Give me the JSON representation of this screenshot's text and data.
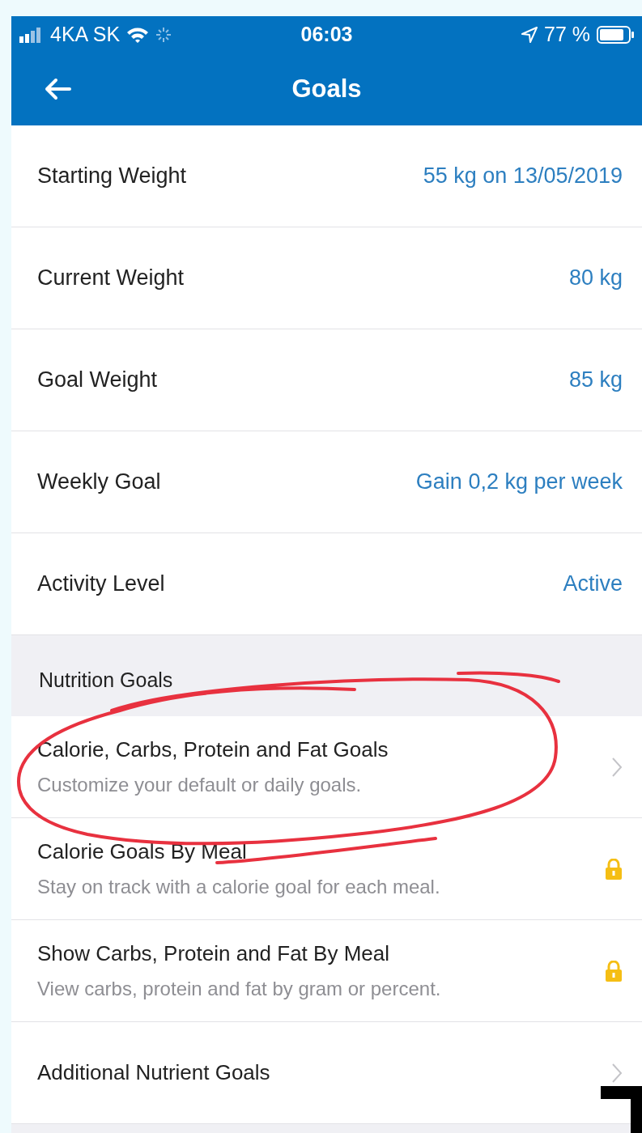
{
  "status_bar": {
    "carrier": "4KA SK",
    "time": "06:03",
    "battery": "77 %"
  },
  "header": {
    "title": "Goals"
  },
  "weight_rows": [
    {
      "label": "Starting Weight",
      "value": "55 kg on 13/05/2019"
    },
    {
      "label": "Current Weight",
      "value": "80 kg"
    },
    {
      "label": "Goal Weight",
      "value": "85 kg"
    },
    {
      "label": "Weekly Goal",
      "value": "Gain 0,2 kg per week"
    },
    {
      "label": "Activity Level",
      "value": "Active"
    }
  ],
  "section_header": "Nutrition Goals",
  "nutrition_rows": [
    {
      "title": "Calorie, Carbs, Protein and Fat Goals",
      "subtitle": "Customize your default or daily goals.",
      "kind": "chevron"
    },
    {
      "title": "Calorie Goals By Meal",
      "subtitle": "Stay on track with a calorie goal for each meal.",
      "kind": "locked"
    },
    {
      "title": "Show Carbs, Protein and Fat By Meal",
      "subtitle": "View carbs, protein and fat by gram or percent.",
      "kind": "locked"
    },
    {
      "title": "Additional Nutrient Goals",
      "kind": "chevron"
    }
  ]
}
